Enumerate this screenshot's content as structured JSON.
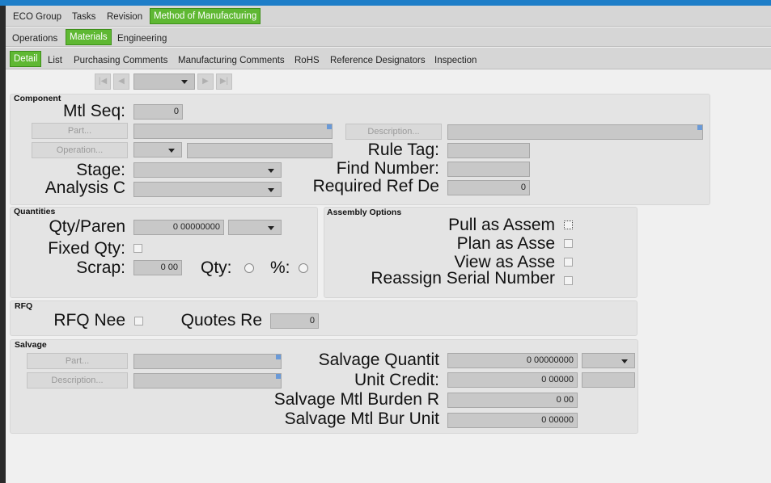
{
  "tabs_l1": [
    "ECO Group",
    "Tasks",
    "Revision",
    "Method of Manufacturing"
  ],
  "tabs_l2": [
    "Operations",
    "Materials",
    "Engineering"
  ],
  "tabs_l3": [
    "Detail",
    "List",
    "Purchasing Comments",
    "Manufacturing Comments",
    "RoHS",
    "Reference Designators",
    "Inspection"
  ],
  "component": {
    "group": "Component",
    "mtl_seq_label": "Mtl Seq:",
    "mtl_seq_value": "0",
    "part_btn": "Part...",
    "description_btn": "Description...",
    "operation_btn": "Operation...",
    "rule_tag_label": "Rule Tag:",
    "stage_label": "Stage:",
    "find_number_label": "Find Number:",
    "analysis_label": "Analysis C",
    "required_ref_label": "Required Ref De",
    "required_ref_value": "0"
  },
  "quantities": {
    "group": "Quantities",
    "qty_paren_label": "Qty/Paren",
    "qty_paren_value": "0 00000000",
    "fixed_qty_label": "Fixed Qty:",
    "scrap_label": "Scrap:",
    "scrap_value": "0 00",
    "qty_label": "Qty:",
    "pct_label": "%:"
  },
  "assembly": {
    "group": "Assembly Options",
    "pull_label": "Pull as Assem",
    "plan_label": "Plan as Asse",
    "view_label": "View as Asse",
    "reassign_label": "Reassign Serial Number"
  },
  "rfq": {
    "group": "RFQ",
    "rfq_need_label": "RFQ Nee",
    "quotes_label": "Quotes Re",
    "quotes_value": "0"
  },
  "salvage": {
    "group": "Salvage",
    "part_btn": "Part...",
    "description_btn": "Description...",
    "quantity_label": "Salvage Quantit",
    "quantity_value": "0 00000000",
    "unit_credit_label": "Unit Credit:",
    "unit_credit_value": "0 00000",
    "burden_rate_label": "Salvage Mtl Burden R",
    "burden_rate_value": "0 00",
    "burden_unit_label": "Salvage Mtl Bur Unit",
    "burden_unit_value": "0 00000"
  }
}
